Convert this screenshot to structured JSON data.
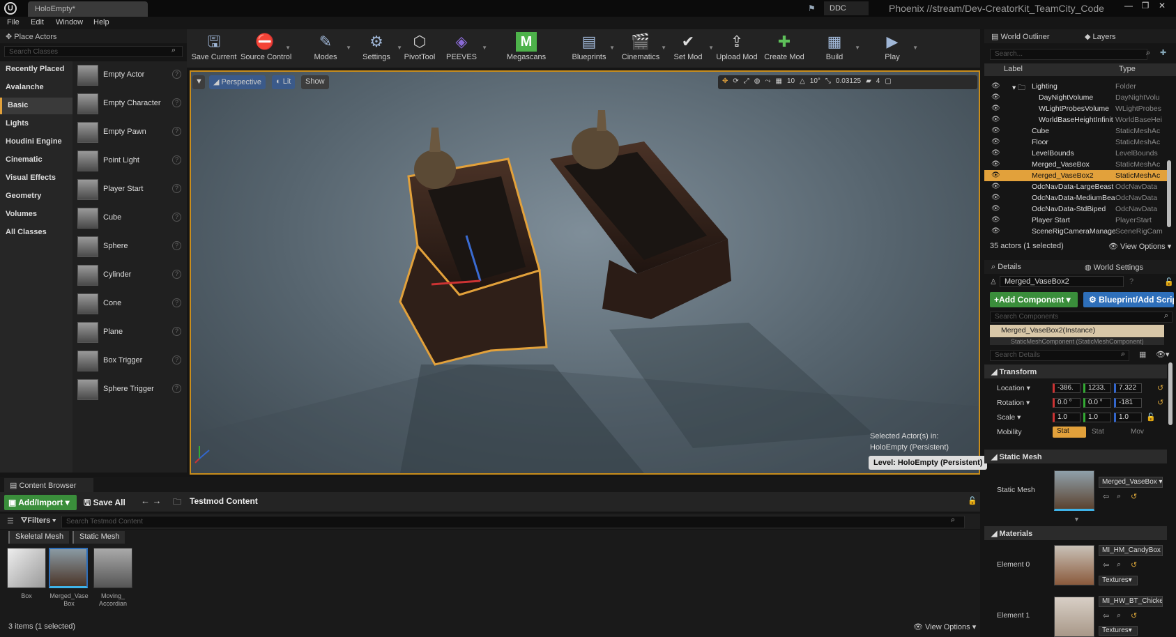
{
  "window": {
    "tab": "HoloEmpty*",
    "ddc": "DDC",
    "project": "Phoenix //stream/Dev-CreatorKit_TeamCity_Code"
  },
  "menu": [
    "File",
    "Edit",
    "Window",
    "Help"
  ],
  "place_actors": {
    "title": "Place Actors",
    "search_placeholder": "Search Classes",
    "categories": [
      "Recently Placed",
      "Avalanche",
      "Basic",
      "Lights",
      "Houdini Engine",
      "Cinematic",
      "Visual Effects",
      "Geometry",
      "Volumes",
      "All Classes"
    ],
    "items": [
      "Empty Actor",
      "Empty Character",
      "Empty Pawn",
      "Point Light",
      "Player Start",
      "Cube",
      "Sphere",
      "Cylinder",
      "Cone",
      "Plane",
      "Box Trigger",
      "Sphere Trigger"
    ]
  },
  "toolbar": [
    "Save Current",
    "Source Control",
    "Modes",
    "Settings",
    "PivotTool",
    "PEEVES",
    "Megascans",
    "Blueprints",
    "Cinematics",
    "Set Mod",
    "Upload Mod",
    "Create Mod",
    "Build",
    "Play"
  ],
  "viewport": {
    "perspective": "Perspective",
    "lit": "Lit",
    "show": "Show",
    "snap_grid": "10",
    "snap_rot": "10°",
    "snap_scale": "0.03125",
    "cam_speed": "4",
    "selected_line1": "Selected Actor(s) in:",
    "selected_line2": "HoloEmpty (Persistent)",
    "level": "Level:  HoloEmpty (Persistent)"
  },
  "content_browser": {
    "tab": "Content Browser",
    "add_import": "Add/Import",
    "save_all": "Save All",
    "path": "Testmod Content",
    "filters": "Filters",
    "search_placeholder": "Search Testmod Content",
    "filter_tags": [
      "Skeletal Mesh",
      "Static Mesh"
    ],
    "assets": [
      {
        "name": "Box"
      },
      {
        "name": "Merged_Vase Box"
      },
      {
        "name": "Moving_ Accordian"
      }
    ],
    "count": "3 items (1 selected)",
    "view_options": "View Options"
  },
  "outliner": {
    "title": "World Outliner",
    "layers": "Layers",
    "search_placeholder": "Search...",
    "col_label": "Label",
    "col_type": "Type",
    "rows": [
      {
        "name": "Lighting",
        "type": "Folder",
        "indent": 1
      },
      {
        "name": "DayNightVolume",
        "type": "DayNightVolu",
        "indent": 2
      },
      {
        "name": "WLightProbesVolume",
        "type": "WLightProbes",
        "indent": 2
      },
      {
        "name": "WorldBaseHeightInfinit",
        "type": "WorldBaseHei",
        "indent": 2
      },
      {
        "name": "Cube",
        "type": "StaticMeshAc",
        "indent": 1
      },
      {
        "name": "Floor",
        "type": "StaticMeshAc",
        "indent": 1
      },
      {
        "name": "LevelBounds",
        "type": "LevelBounds",
        "indent": 1
      },
      {
        "name": "Merged_VaseBox",
        "type": "StaticMeshAc",
        "indent": 1
      },
      {
        "name": "Merged_VaseBox2",
        "type": "StaticMeshAc",
        "indent": 1,
        "selected": true
      },
      {
        "name": "OdcNavData-LargeBeast",
        "type": "OdcNavData",
        "indent": 1
      },
      {
        "name": "OdcNavData-MediumBea",
        "type": "OdcNavData",
        "indent": 1
      },
      {
        "name": "OdcNavData-StdBiped",
        "type": "OdcNavData",
        "indent": 1
      },
      {
        "name": "Player Start",
        "type": "PlayerStart",
        "indent": 1
      },
      {
        "name": "SceneRigCameraManage",
        "type": "SceneRigCam",
        "indent": 1
      }
    ],
    "count": "35 actors (1 selected)",
    "view_options": "View Options"
  },
  "details": {
    "title": "Details",
    "world_settings": "World Settings",
    "name": "Merged_VaseBox2",
    "add_component": "Add Component",
    "blueprint_add": "Blueprint/Add Script",
    "search_components": "Search Components",
    "instance": "Merged_VaseBox2(Instance)",
    "sub_component": "StaticMeshComponent (StaticMeshComponent)",
    "search_details": "Search Details",
    "transform": {
      "section": "Transform",
      "location_label": "Location",
      "location": [
        "-386.",
        "1233.",
        "7.322"
      ],
      "rotation_label": "Rotation",
      "rotation": [
        "0.0 °",
        "0.0 °",
        "-181"
      ],
      "scale_label": "Scale",
      "scale": [
        "1.0",
        "1.0",
        "1.0"
      ],
      "mobility_label": "Mobility",
      "mobility": [
        "Stat",
        "Stat",
        "Mov"
      ]
    },
    "static_mesh": {
      "section": "Static Mesh",
      "label": "Static Mesh",
      "value": "Merged_VaseBox"
    },
    "materials": {
      "section": "Materials",
      "el0": "Element 0",
      "mat0": "MI_HM_CandyBox",
      "el1": "Element 1",
      "mat1": "MI_HW_BT_Chicken",
      "textures": "Textures"
    }
  },
  "colors": {
    "accent": "#e2a13b",
    "green": "#3a8e3b",
    "blue": "#2e6fba"
  }
}
